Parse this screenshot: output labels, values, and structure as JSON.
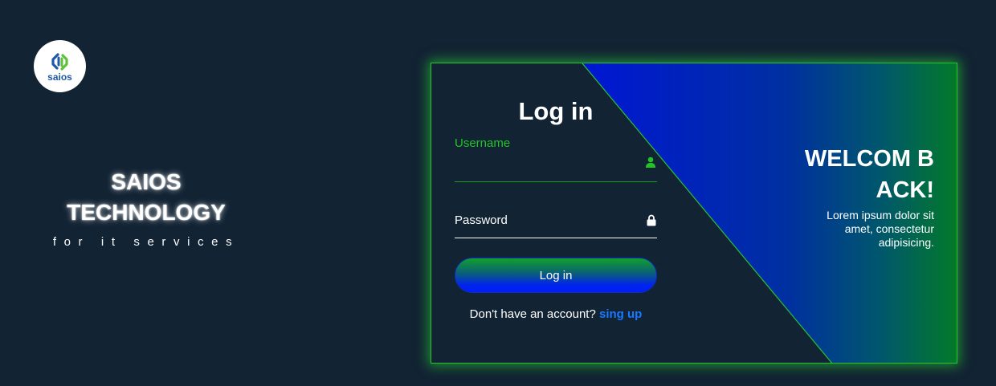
{
  "logo": {
    "text": "saios"
  },
  "brand": {
    "name_line1": "SAIOS",
    "name_line2": "TECHNOLOGY",
    "tagline": "for it services"
  },
  "login_form": {
    "title": "Log in",
    "username_label": "Username",
    "username_icon": "user-icon",
    "password_label": "Password",
    "password_icon": "lock-icon",
    "submit_label": "Log in",
    "signup_prompt": "Don't have an account?",
    "signup_link": "sing up"
  },
  "welcome": {
    "title": "WELCOM BACK!",
    "text": "Lorem ipsum dolor sit amet, consectetur adipisicing."
  },
  "colors": {
    "background": "#122333",
    "accent_green": "#23c328",
    "accent_blue": "#0022f0",
    "link_blue": "#1b78ff"
  }
}
